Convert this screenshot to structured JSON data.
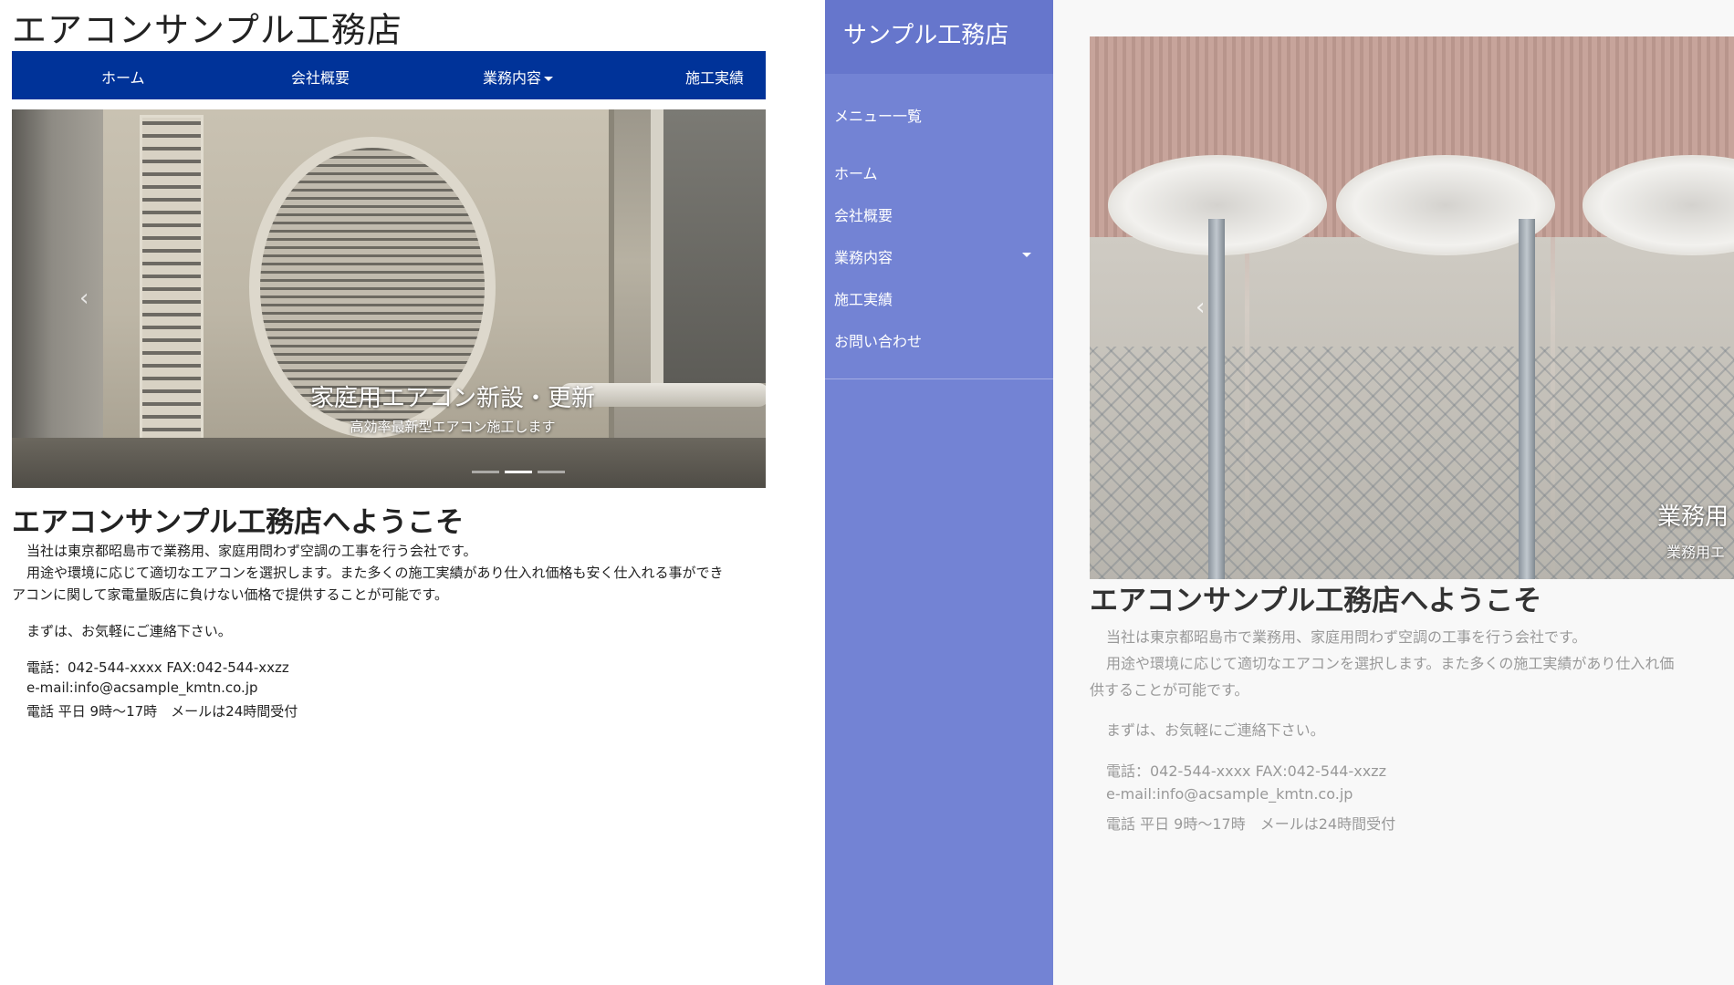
{
  "left": {
    "site_title": "エアコンサンプル工務店",
    "nav": {
      "items": [
        {
          "label": "ホーム"
        },
        {
          "label": "会社概要"
        },
        {
          "label": "業務内容"
        },
        {
          "label": "施工実績"
        }
      ]
    },
    "carousel": {
      "prev_glyph": "‹",
      "caption_title": "家庭用エアコン新設・更新",
      "caption_sub": "高効率最新型エアコン施工します",
      "indicator_count": 3,
      "active_indicator": 2
    },
    "welcome": "エアコンサンプル工務店へようこそ",
    "paragraph_line1": "当社は東京都昭島市で業務用、家庭用問わず空調の工事を行う会社です。",
    "paragraph_line2": "用途や環境に応じて適切なエアコンを選択します。また多くの施工実績があり仕入れ価格も安く仕入れる事ができ",
    "paragraph_line3": "アコンに関して家電量販店に負けない価格で提供することが可能です。",
    "contact_prompt": "まずは、お気軽にご連絡下さい。",
    "phone": "電話：042-544-xxxx FAX:042-544-xxzz",
    "email": "e-mail:info@acsample_kmtn.co.jp",
    "hours": "電話 平日 9時～17時　メールは24時間受付"
  },
  "sidebar": {
    "title": "サンプル工務店",
    "menu_label": "メニュー一覧",
    "items": [
      {
        "label": "ホーム"
      },
      {
        "label": "会社概要"
      },
      {
        "label": "業務内容"
      },
      {
        "label": "施工実績"
      },
      {
        "label": "お問い合わせ"
      }
    ]
  },
  "right": {
    "carousel": {
      "prev_glyph": "‹",
      "caption_title": "業務用",
      "caption_sub": "業務用エ"
    },
    "welcome": "エアコンサンプル工務店へようこそ",
    "paragraph_line1": "当社は東京都昭島市で業務用、家庭用問わず空調の工事を行う会社です。",
    "paragraph_line2": "用途や環境に応じて適切なエアコンを選択します。また多くの施工実績があり仕入れ価",
    "paragraph_line3": "供することが可能です。",
    "contact_prompt": "まずは、お気軽にご連絡下さい。",
    "phone": "電話：042-544-xxxx FAX:042-544-xxzz",
    "email": "e-mail:info@acsample_kmtn.co.jp",
    "hours": "電話 平日 9時～17時　メールは24時間受付"
  },
  "colors": {
    "nav_bg": "#003399",
    "sidebar_bg": "#7383d4",
    "sidebar_header_bg": "#6676cc",
    "right_text": "#999999"
  }
}
